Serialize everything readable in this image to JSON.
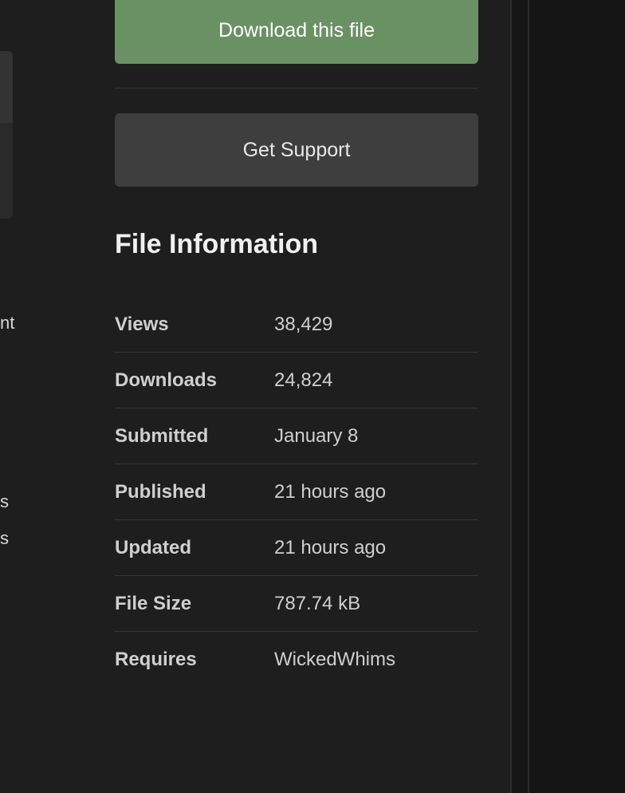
{
  "left_column": {
    "fragments": [
      "nt",
      "s",
      "s"
    ]
  },
  "actions": {
    "download_label": "Download this file",
    "support_label": "Get Support"
  },
  "file_info": {
    "title": "File Information",
    "rows": [
      {
        "label": "Views",
        "value": "38,429"
      },
      {
        "label": "Downloads",
        "value": "24,824"
      },
      {
        "label": "Submitted",
        "value": "January 8"
      },
      {
        "label": "Published",
        "value": "21 hours ago"
      },
      {
        "label": "Updated",
        "value": "21 hours ago"
      },
      {
        "label": "File Size",
        "value": "787.74 kB"
      },
      {
        "label": "Requires",
        "value": "WickedWhims"
      }
    ]
  },
  "colors": {
    "background": "#1e1e1e",
    "download_button": "#6a9163",
    "support_button": "#3e3e3e",
    "text": "#cfcfcf"
  }
}
